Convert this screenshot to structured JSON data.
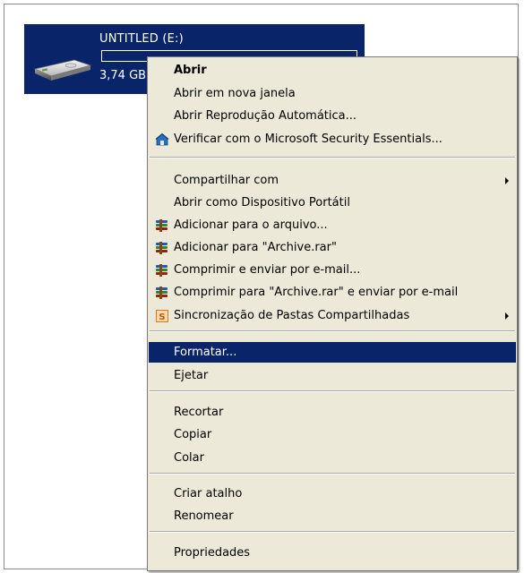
{
  "drive": {
    "name": "UNTITLED (E:)",
    "size_text": "3,74 GB",
    "usage_fraction": 0.0,
    "icon": "usb-drive-icon"
  },
  "menu": {
    "items": [
      {
        "label": "Abrir",
        "bold": true
      },
      {
        "label": "Abrir em nova janela"
      },
      {
        "label": "Abrir Reprodução Automática..."
      },
      {
        "label": "Verificar com o Microsoft Security Essentials...",
        "icon": "security-essentials-icon"
      },
      {
        "label": "Compartilhar com",
        "submenu": true
      },
      {
        "label": "Abrir como Dispositivo Portátil"
      },
      {
        "label": "Adicionar para o arquivo...",
        "icon": "winrar-icon"
      },
      {
        "label": "Adicionar para \"Archive.rar\"",
        "icon": "winrar-icon"
      },
      {
        "label": "Comprimir e enviar por e-mail...",
        "icon": "winrar-icon"
      },
      {
        "label": "Comprimir para \"Archive.rar\" e enviar por e-mail",
        "icon": "winrar-icon"
      },
      {
        "label": "Sincronização de Pastas Compartilhadas",
        "icon": "sync-icon",
        "submenu": true
      },
      {
        "label": "Formatar...",
        "highlighted": true
      },
      {
        "label": "Ejetar"
      },
      {
        "label": "Recortar"
      },
      {
        "label": "Copiar"
      },
      {
        "label": "Colar"
      },
      {
        "label": "Criar atalho"
      },
      {
        "label": "Renomear"
      },
      {
        "label": "Propriedades"
      }
    ]
  },
  "colors": {
    "selection": "#0a246a",
    "menu_background": "#ece9d8",
    "winrar_red": "#a01818",
    "sync_orange": "#e07818"
  }
}
